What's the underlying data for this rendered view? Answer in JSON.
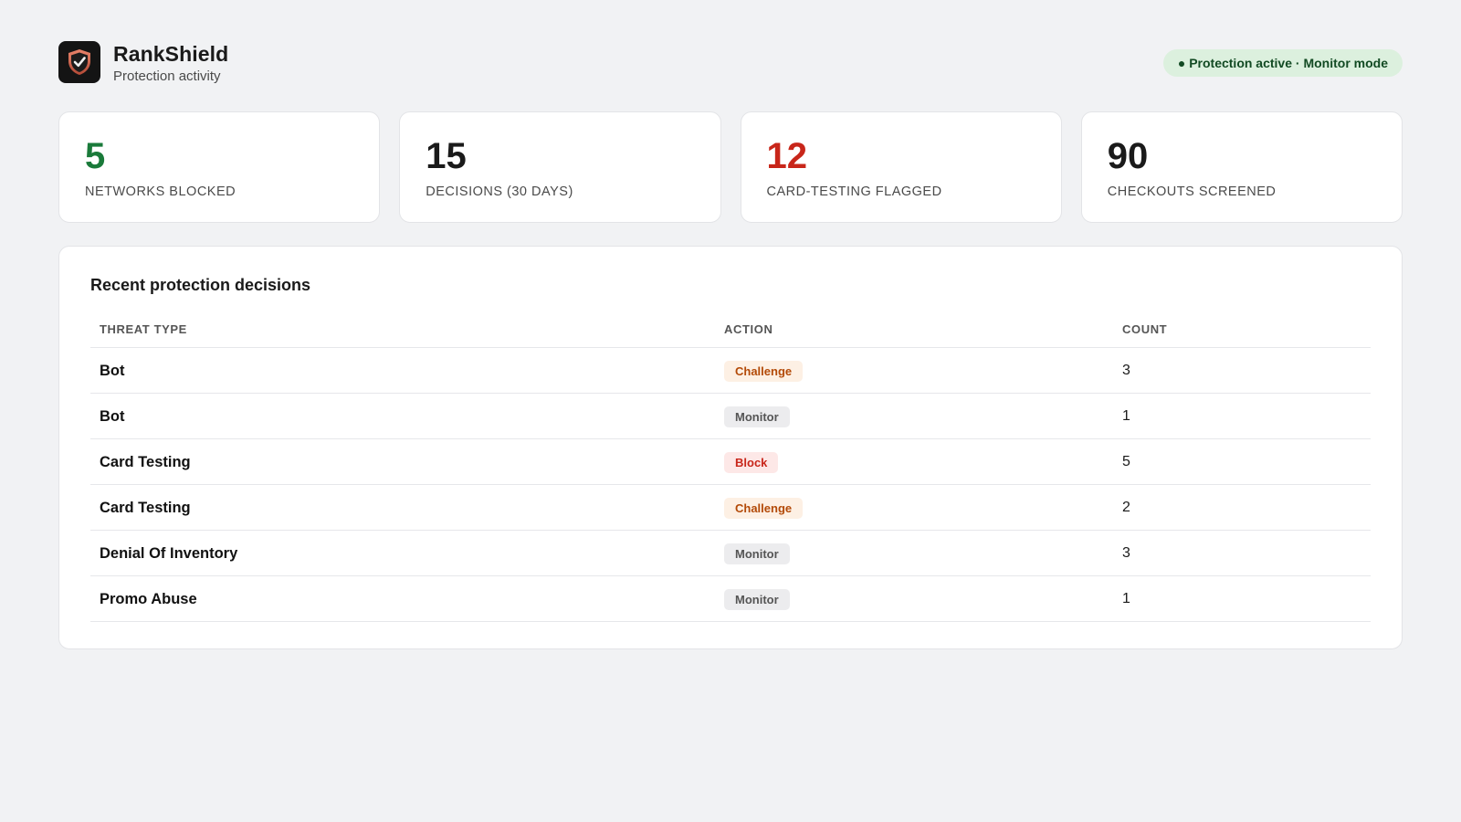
{
  "brand": {
    "name": "RankShield",
    "subtitle": "Protection activity"
  },
  "status": {
    "label": "● Protection active · Monitor mode",
    "color": "#124a23",
    "background": "#dcf0de"
  },
  "stats": [
    {
      "value": "5",
      "label": "NETWORKS BLOCKED",
      "color": "#1a7a3a"
    },
    {
      "value": "15",
      "label": "DECISIONS (30 DAYS)",
      "color": "#1a1a1a"
    },
    {
      "value": "12",
      "label": "CARD-TESTING FLAGGED",
      "color": "#c8261a"
    },
    {
      "value": "90",
      "label": "CHECKOUTS SCREENED",
      "color": "#1a1a1a"
    }
  ],
  "decisions": {
    "title": "Recent protection decisions",
    "columns": [
      "THREAT TYPE",
      "ACTION",
      "COUNT"
    ],
    "rows": [
      {
        "threat": "Bot",
        "action": "Challenge",
        "action_kind": "challenge",
        "count": "3"
      },
      {
        "threat": "Bot",
        "action": "Monitor",
        "action_kind": "monitor",
        "count": "1"
      },
      {
        "threat": "Card Testing",
        "action": "Block",
        "action_kind": "block",
        "count": "5"
      },
      {
        "threat": "Card Testing",
        "action": "Challenge",
        "action_kind": "challenge",
        "count": "2"
      },
      {
        "threat": "Denial Of Inventory",
        "action": "Monitor",
        "action_kind": "monitor",
        "count": "3"
      },
      {
        "threat": "Promo Abuse",
        "action": "Monitor",
        "action_kind": "monitor",
        "count": "1"
      }
    ]
  },
  "icons": {
    "logo": "shield-check-icon"
  }
}
